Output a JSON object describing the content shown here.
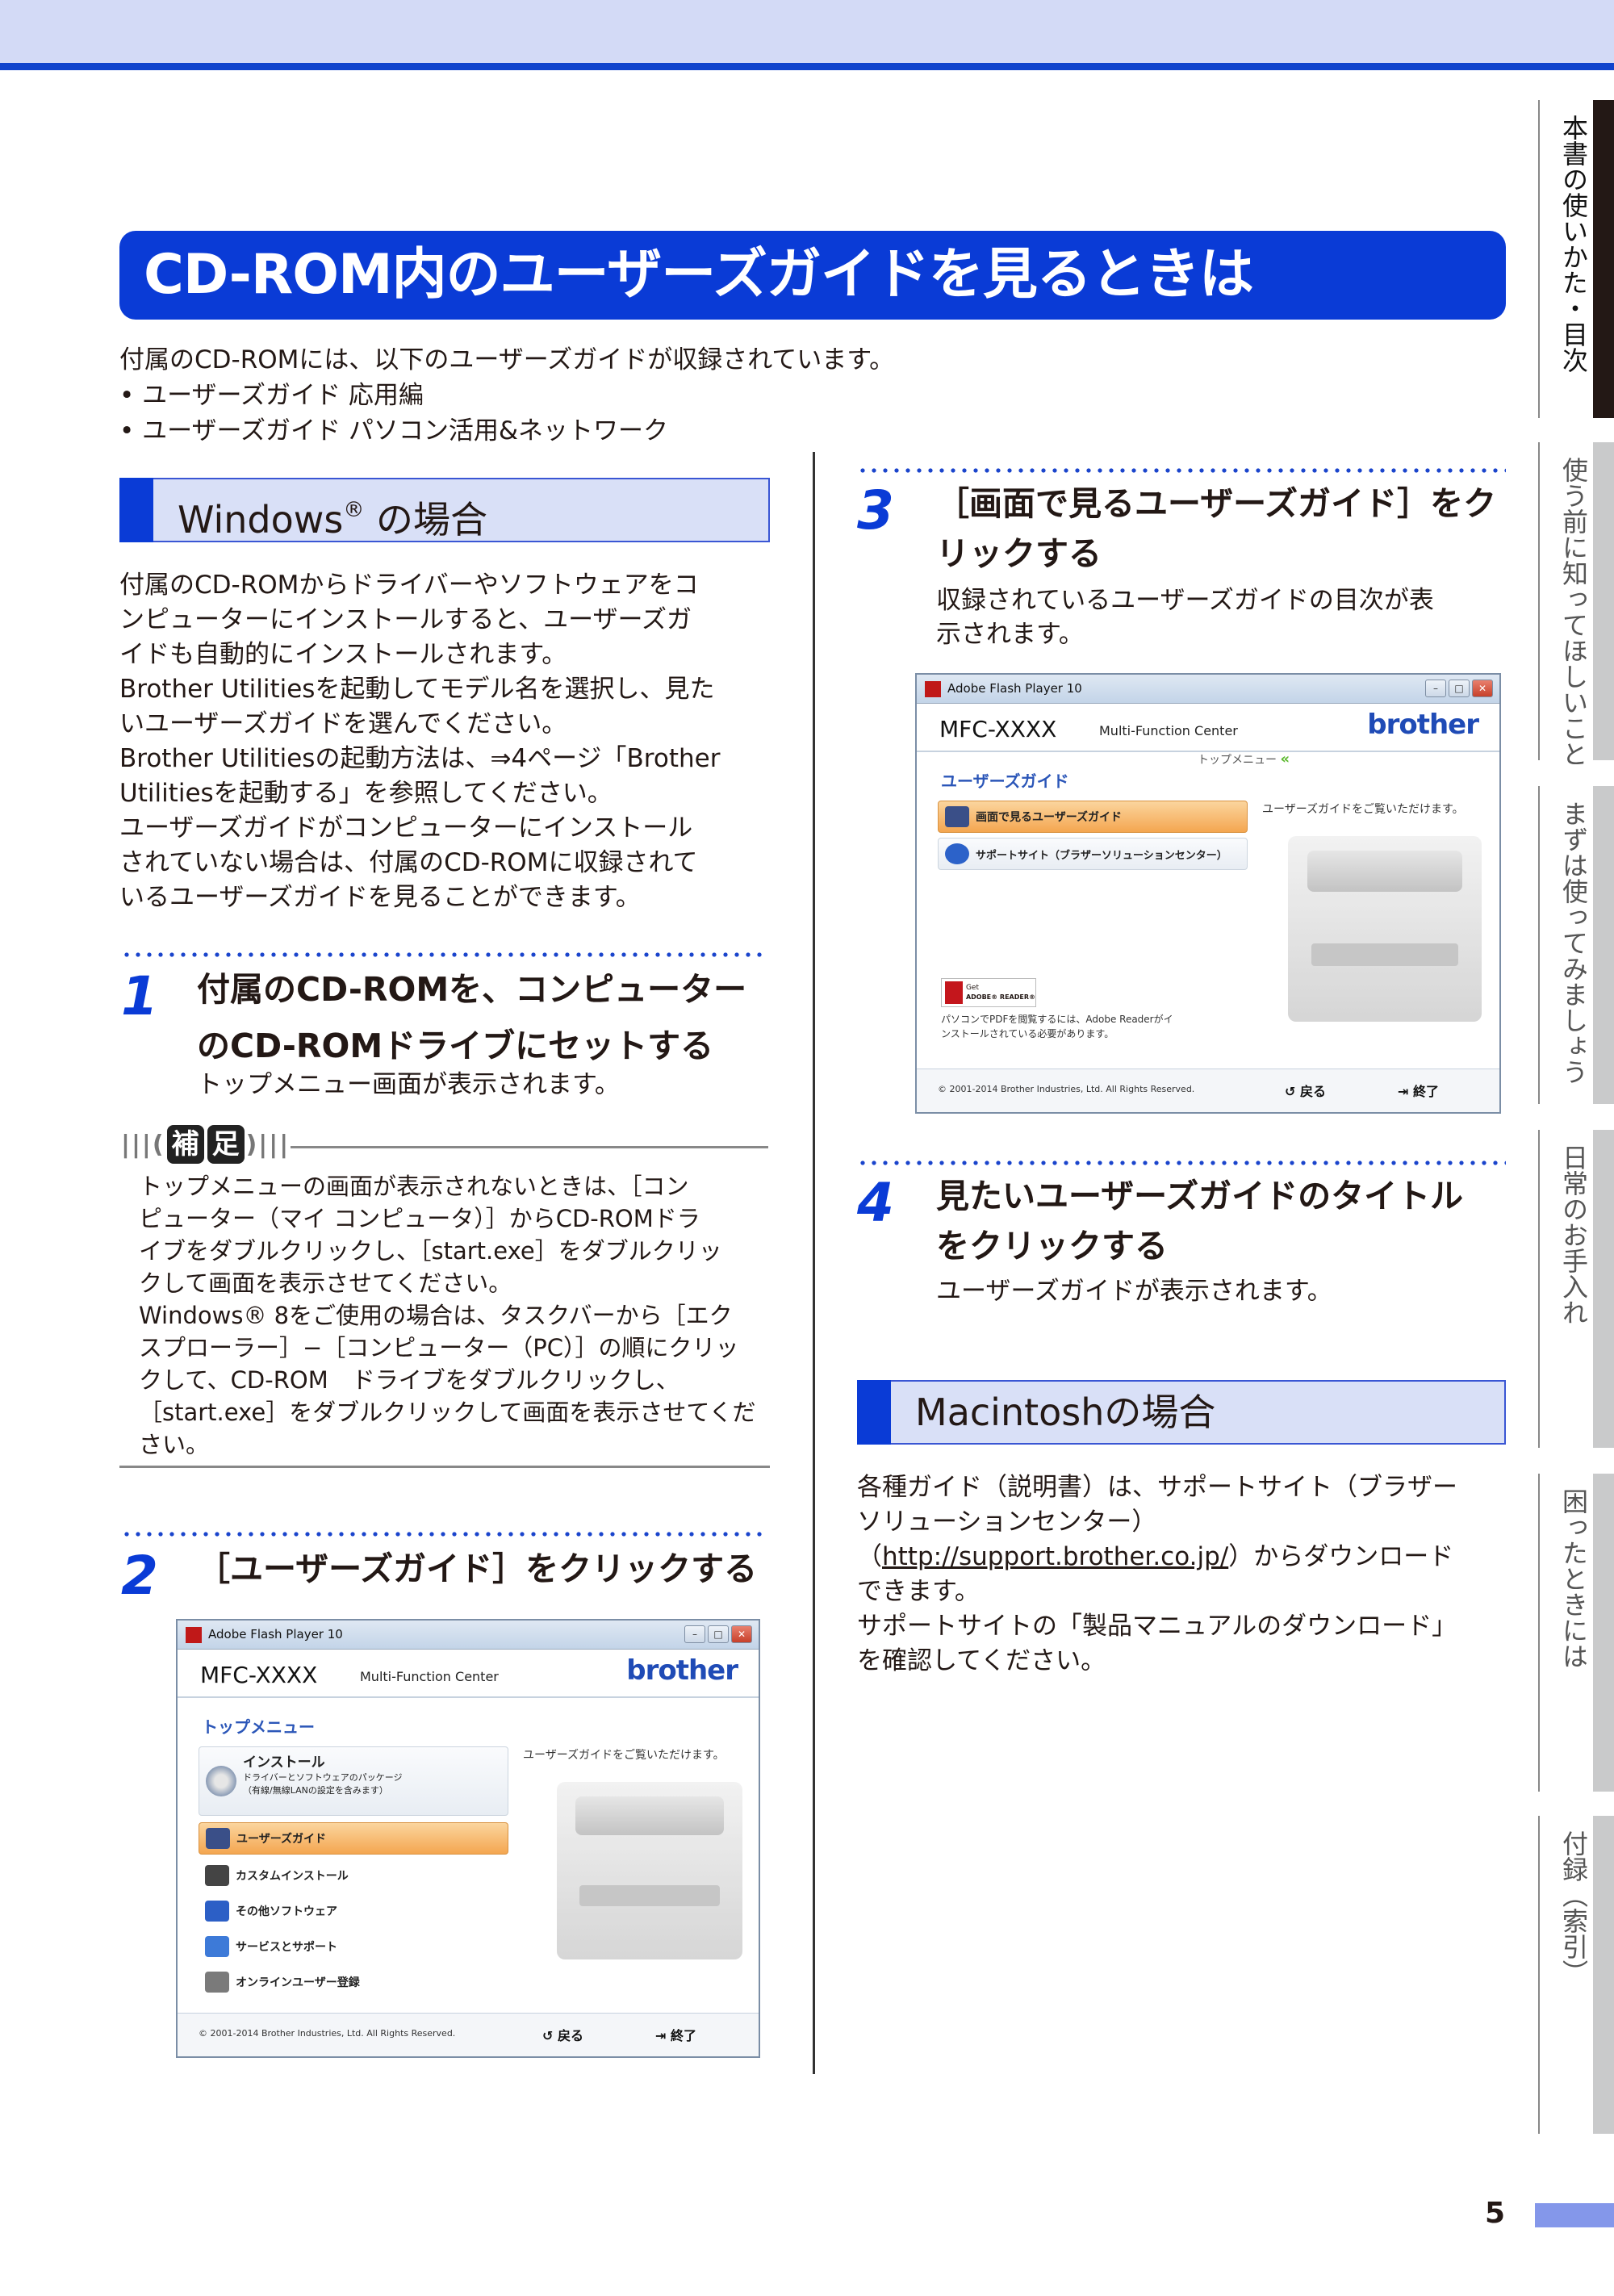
{
  "page_title": "CD-ROM内のユーザーズガイドを見るときは",
  "intro": {
    "line1": "付属のCD-ROMには、以下のユーザーズガイドが収録されています。",
    "bullet1": "•  ユーザーズガイド 応用編",
    "bullet2": "•  ユーザーズガイド パソコン活用&ネットワーク"
  },
  "windows_section": {
    "heading": "Windows",
    "heading_reg": "®",
    "heading_suffix": " の場合",
    "body": [
      "付属のCD-ROMからドライバーやソフトウェアをコ",
      "ンピューターにインストールすると、ユーザーズガ",
      "イドも自動的にインストールされます。",
      "Brother Utilitiesを起動してモデル名を選択し、見た",
      "いユーザーズガイドを選んでください。",
      "Brother Utilitiesの起動方法は、⇒4ページ「Brother",
      "Utilitiesを起動する」を参照してください。",
      "ユーザーズガイドがコンピューターにインストール",
      "されていない場合は、付属のCD-ROMに収録されて",
      "いるユーザーズガイドを見ることができます。"
    ]
  },
  "step1": {
    "num": "1",
    "title_line1": "付属のCD-ROMを、コンピューター",
    "title_line2": "のCD-ROMドライブにセットする",
    "body": "トップメニュー画面が表示されます。"
  },
  "hosoku": {
    "badge1": "補",
    "badge2": "足",
    "lines": [
      "トップメニューの画面が表示されないときは、［コン",
      "ピューター（マイ コンピュータ）］からCD-ROMドラ",
      "イブをダブルクリックし、［start.exe］をダブルクリッ",
      "クして画面を表示させてください。",
      "Windows® 8をご使用の場合は、タスクバーから［エク",
      "スプローラー］−［コンピューター（PC）］の順にクリッ",
      "クして、CD-ROM　ドライブをダブルクリックし、",
      "［start.exe］をダブルクリックして画面を表示させてくだ",
      "さい。"
    ]
  },
  "step2": {
    "num": "2",
    "title": "［ユーザーズガイド］をクリックする"
  },
  "window_common": {
    "titlebar": "Adobe Flash Player 10",
    "model": "MFC-XXXX",
    "subtitle": "Multi-Function Center",
    "logo": "brother",
    "copyright": "© 2001-2014 Brother Industries, Ltd. All Rights Reserved.",
    "back": "↺ 戻る",
    "exit": "⇥ 終了",
    "hint": "ユーザーズガイドをご覧いただけます。"
  },
  "window_top": {
    "menu_header": "トップメニュー",
    "install_title": "インストール",
    "install_sub1": "ドライバーとソフトウェアのパッケージ",
    "install_sub2": "（有線/無線LANの設定を含みます）",
    "items": [
      "ユーザーズガイド",
      "カスタムインストール",
      "その他ソフトウェア",
      "サービスとサポート",
      "オンラインユーザー登録"
    ]
  },
  "window_guide": {
    "breadcrumb": "トップメニュー",
    "breadcrumb_arrow": "«",
    "menu_header": "ユーザーズガイド",
    "item1": "画面で見るユーザーズガイド",
    "item2": "サポートサイト（ブラザーソリューションセンター）",
    "adobe_get": "Get",
    "adobe_name": "ADOBE® READER®",
    "adobe_note1": "パソコンでPDFを閲覧するには、Adobe Readerがイ",
    "adobe_note2": "ンストールされている必要があります。"
  },
  "step3": {
    "num": "3",
    "title_line1": "［画面で見るユーザーズガイド］をク",
    "title_line2": "リックする",
    "body1": "収録されているユーザーズガイドの目次が表",
    "body2": "示されます。"
  },
  "step4": {
    "num": "4",
    "title_line1": "見たいユーザーズガイドのタイトル",
    "title_line2": "をクリックする",
    "body": "ユーザーズガイドが表示されます。"
  },
  "mac_section": {
    "heading": "Macintoshの場合",
    "line1": "各種ガイド（説明書）は、サポートサイト（ブラザー",
    "line2": "ソリューションセンター）",
    "link": "http://support.brother.co.jp/",
    "line3_open": "（",
    "line3_close": "）からダウンロード",
    "line4": "できます。",
    "line5": "サポートサイトの「製品マニュアルのダウンロード」",
    "line6": "を確認してください。"
  },
  "side_tabs": [
    "本書の使いかた・目次",
    "使う前に知ってほしいこと",
    "まずは使ってみましょう",
    "日常のお手入れ",
    "困ったときには",
    "付録（索引）"
  ],
  "page_number": "5"
}
